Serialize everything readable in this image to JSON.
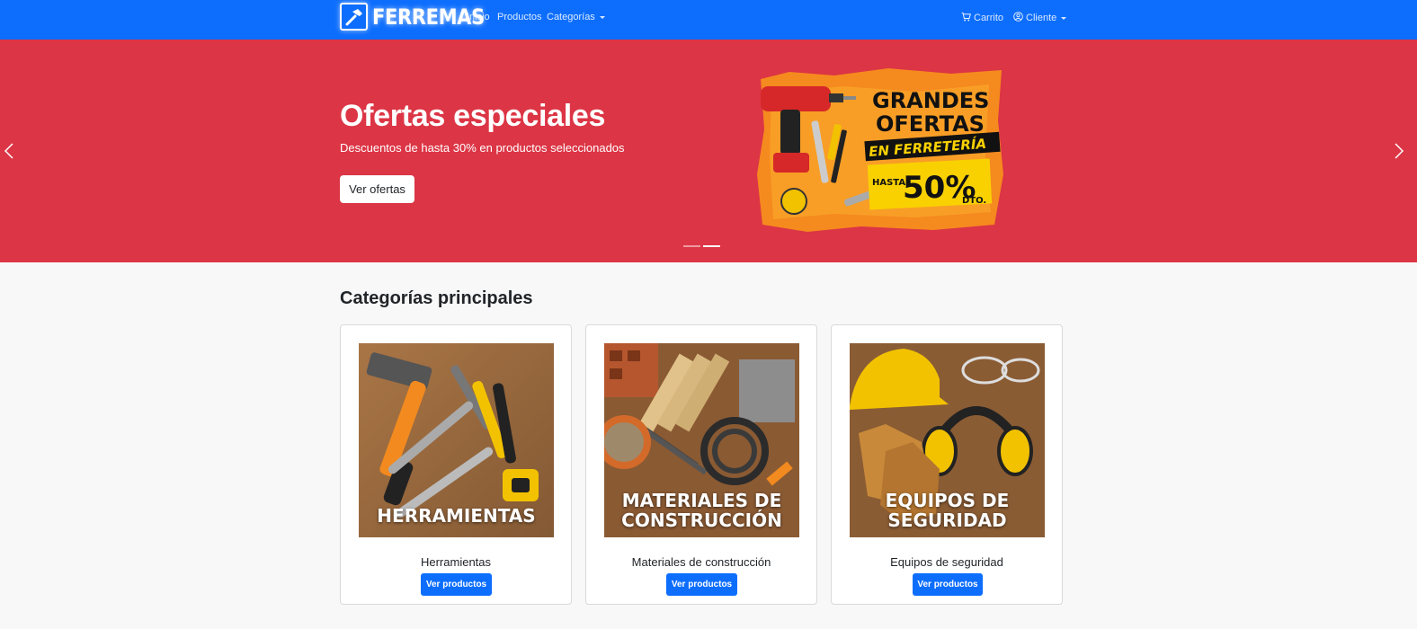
{
  "navbar": {
    "brand": "FERREMAS",
    "links": [
      {
        "label": "Inicio"
      },
      {
        "label": "Productos"
      },
      {
        "label": "Categorías"
      }
    ],
    "cart_label": "Carrito",
    "user_label": "Cliente",
    "color": "#0d6efd"
  },
  "hero": {
    "title": "Ofertas especiales",
    "subtitle": "Descuentos de hasta 30% en productos seleccionados",
    "button_label": "Ver ofertas",
    "color": "#dc3545",
    "active_slide": 2,
    "slide_count": 2,
    "promo": {
      "line1": "GRANDES",
      "line2": "OFERTAS",
      "line3": "EN FERRETERÍA",
      "prefix": "HASTA",
      "percent": "50%",
      "suffix": "DTO."
    }
  },
  "categories": {
    "title": "Categorías principales",
    "items": [
      {
        "image_label_1": "HERRAMIENTAS",
        "image_label_2": "",
        "name": "Herramientas",
        "button": "Ver productos"
      },
      {
        "image_label_1": "MATERIALES DE",
        "image_label_2": "CONSTRUCCIÓN",
        "name": "Materiales de construcción",
        "button": "Ver productos"
      },
      {
        "image_label_1": "EQUIPOS DE",
        "image_label_2": "SEGURIDAD",
        "name": "Equipos de seguridad",
        "button": "Ver productos"
      }
    ]
  }
}
